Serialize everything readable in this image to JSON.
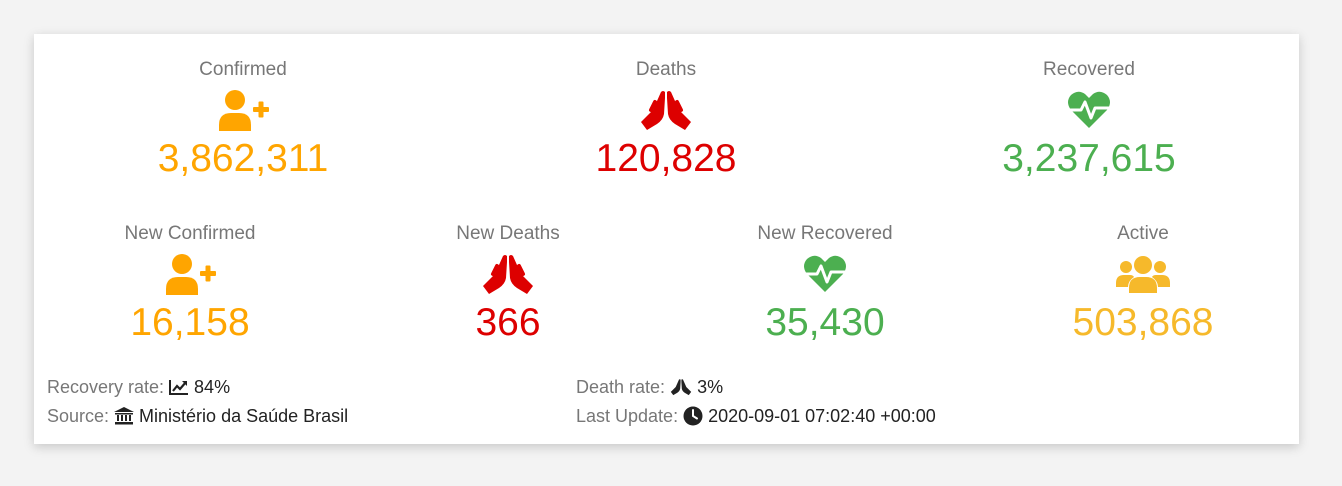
{
  "colors": {
    "confirmed": "#ffa500",
    "deaths": "#dd0000",
    "recovered": "#4caf50",
    "active": "#f6b92b",
    "label": "#777777"
  },
  "confirmed": {
    "label": "Confirmed",
    "value": "3,862,311",
    "icon": "user-plus-icon"
  },
  "deaths": {
    "label": "Deaths",
    "value": "120,828",
    "icon": "praying-hands-icon"
  },
  "recovered": {
    "label": "Recovered",
    "value": "3,237,615",
    "icon": "heartbeat-icon"
  },
  "new_confirmed": {
    "label": "New Confirmed",
    "value": "16,158",
    "icon": "user-plus-icon"
  },
  "new_deaths": {
    "label": "New Deaths",
    "value": "366",
    "icon": "praying-hands-icon"
  },
  "new_recovered": {
    "label": "New Recovered",
    "value": "35,430",
    "icon": "heartbeat-icon"
  },
  "active": {
    "label": "Active",
    "value": "503,868",
    "icon": "users-icon"
  },
  "footer": {
    "recovery_rate_label": "Recovery rate:",
    "recovery_rate_value": "84%",
    "recovery_rate_icon": "chart-line-icon",
    "death_rate_label": "Death rate:",
    "death_rate_value": "3%",
    "death_rate_icon": "praying-hands-icon",
    "source_label": "Source:",
    "source_value": "Ministério da Saúde Brasil",
    "source_icon": "landmark-icon",
    "last_update_label": "Last Update:",
    "last_update_value": "2020-09-01 07:02:40 +00:00",
    "last_update_icon": "clock-icon"
  }
}
